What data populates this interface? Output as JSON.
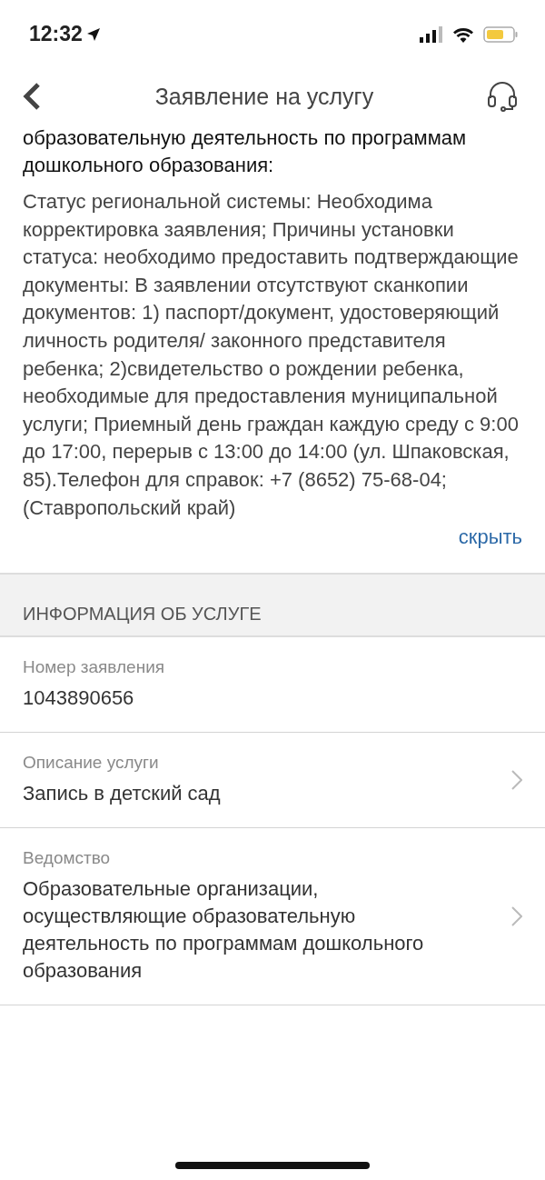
{
  "status_bar": {
    "time": "12:32"
  },
  "header": {
    "title": "Заявление на услугу"
  },
  "status_info": {
    "heading": "образовательную деятельность по программам дошкольного образования:",
    "body": "Статус региональной системы: Необходима корректировка заявления; Причины установки статуса: необходимо предоставить подтверждающие документы: В заявлении отсутствуют сканкопии документов: 1) паспорт/документ, удостоверяющий личность родителя/ законного представителя ребенка; 2)свидетельство о рождении ребенка, необходимые для предоставления муниципальной услуги; Приемный день граждан каждую среду с 9:00 до 17:00, перерыв с 13:00 до 14:00 (ул. Шпаковская, 85).Телефон для справок: +7 (8652) 75-68-04; (Ставропольский край)",
    "toggle": "скрыть"
  },
  "section": {
    "title": "ИНФОРМАЦИЯ ОБ УСЛУГЕ",
    "fields": [
      {
        "label": "Номер заявления",
        "value": "1043890656",
        "kind": "plain"
      },
      {
        "label": "Описание услуги",
        "value": "Запись в детский сад",
        "kind": "link"
      },
      {
        "label": "Ведомство",
        "value": "Образовательные организации, осуществляющие образовательную деятельность по программам дошкольного образования",
        "kind": "link"
      }
    ]
  }
}
